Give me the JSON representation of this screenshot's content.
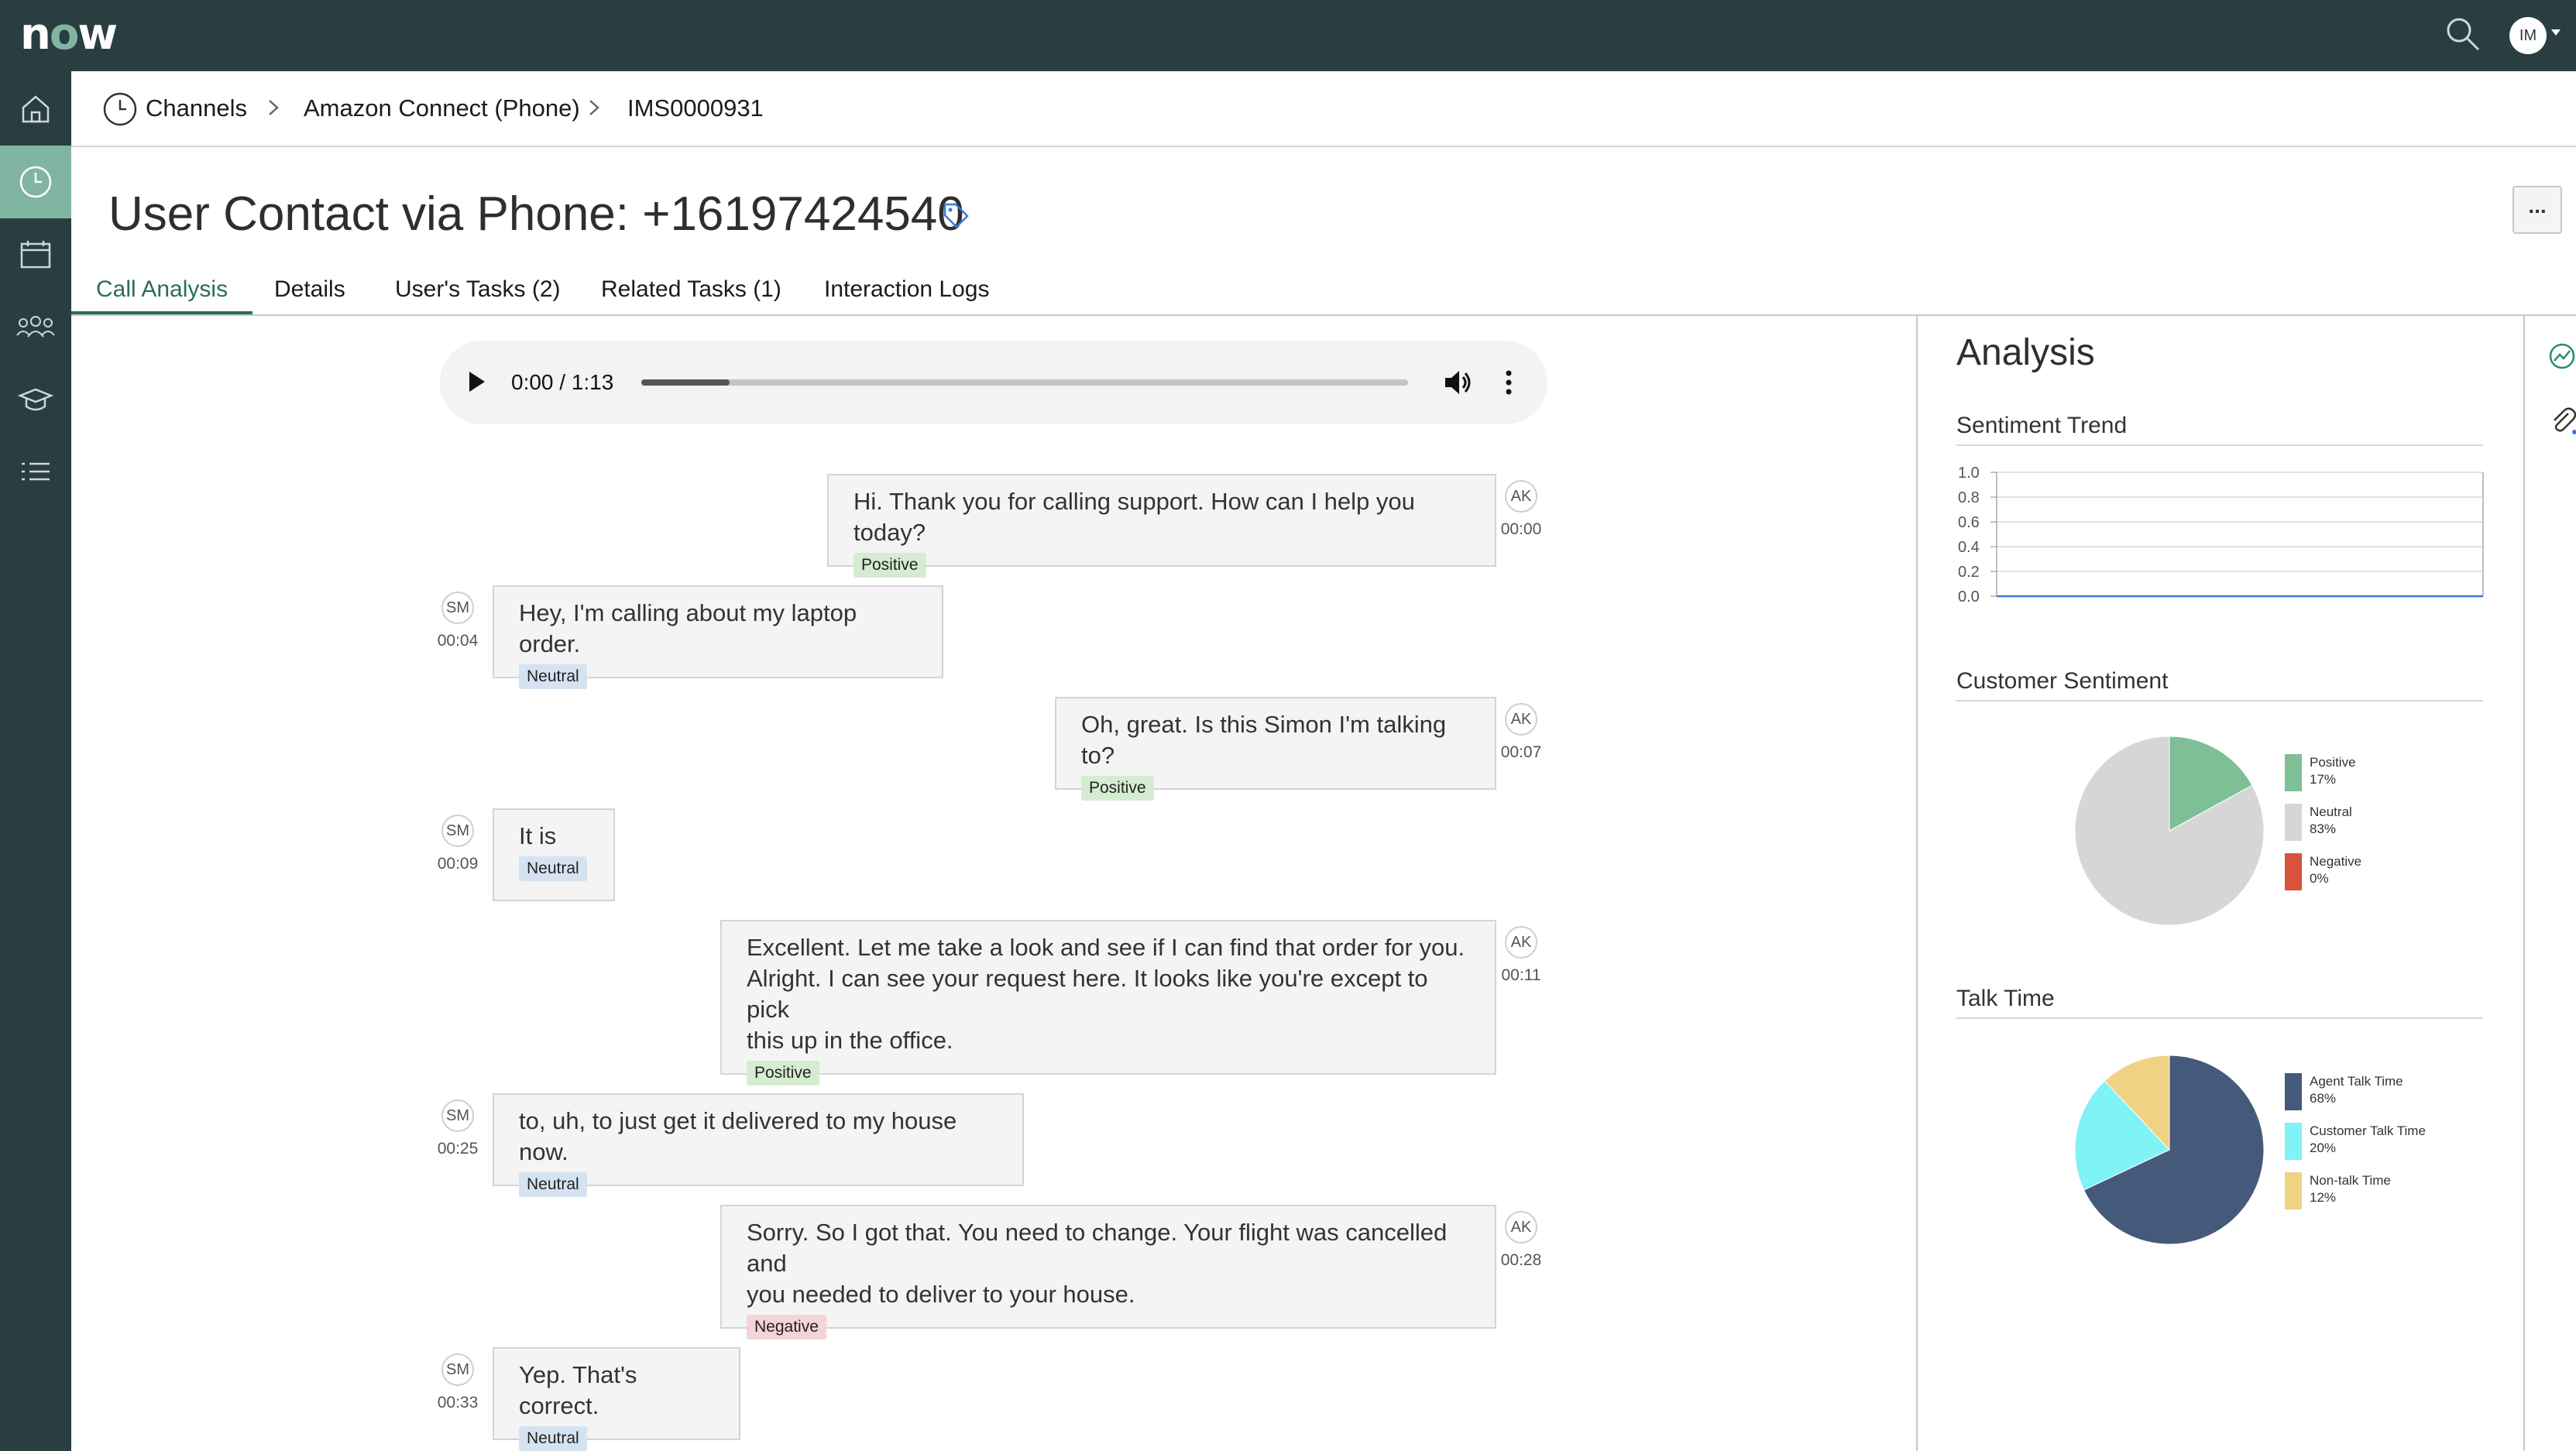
{
  "app": {
    "logo": "now",
    "avatar_initials": "IM"
  },
  "breadcrumb": [
    "Channels",
    "Amazon Connect (Phone)",
    "IMS0000931"
  ],
  "page": {
    "title": "User Contact via Phone: +16197424540",
    "more_label": "..."
  },
  "tabs": [
    {
      "label": "Call Analysis",
      "active": true
    },
    {
      "label": "Details",
      "active": false
    },
    {
      "label": "User's Tasks (2)",
      "active": false
    },
    {
      "label": "Related Tasks (1)",
      "active": false
    },
    {
      "label": "Interaction Logs",
      "active": false
    }
  ],
  "audio": {
    "time": "0:00 / 1:13",
    "progress_fraction": 0.0
  },
  "transcript": [
    {
      "speaker": "AK",
      "time": "00:00",
      "lines": [
        "Hi. Thank you for calling support. How can I help you today?"
      ],
      "sentiment": "Positive"
    },
    {
      "speaker": "SM",
      "time": "00:04",
      "lines": [
        "Hey, I'm calling about my laptop order."
      ],
      "sentiment": "Neutral"
    },
    {
      "speaker": "AK",
      "time": "00:07",
      "lines": [
        "Oh, great. Is this Simon I'm talking to?"
      ],
      "sentiment": "Positive"
    },
    {
      "speaker": "SM",
      "time": "00:09",
      "lines": [
        "It is"
      ],
      "sentiment": "Neutral"
    },
    {
      "speaker": "AK",
      "time": "00:11",
      "lines": [
        "Excellent. Let me take a look and see if I can find that order for you.",
        "Alright. I can see your request here. It looks like you're except to pick",
        "this up in the office."
      ],
      "sentiment": "Positive"
    },
    {
      "speaker": "SM",
      "time": "00:25",
      "lines": [
        "to, uh, to just get it delivered to my house now."
      ],
      "sentiment": "Neutral"
    },
    {
      "speaker": "AK",
      "time": "00:28",
      "lines": [
        "Sorry. So I got that. You need to change. Your flight was cancelled and",
        "you needed to deliver to your house."
      ],
      "sentiment": "Negative"
    },
    {
      "speaker": "SM",
      "time": "00:33",
      "lines": [
        "Yep. That's correct."
      ],
      "sentiment": "Neutral"
    }
  ],
  "analysis": {
    "title": "Analysis",
    "sentiment_trend_title": "Sentiment Trend",
    "customer_sentiment_title": "Customer Sentiment",
    "talk_time_title": "Talk Time"
  },
  "chart_data": [
    {
      "type": "line",
      "title": "Sentiment Trend",
      "yticks": [
        "1.0",
        "0.8",
        "0.6",
        "0.4",
        "0.2",
        "0.0"
      ],
      "ylim": [
        0,
        1
      ],
      "grid": true,
      "series": []
    },
    {
      "type": "pie",
      "title": "Customer Sentiment",
      "legend_position": "right",
      "slices": [
        {
          "name": "Positive",
          "value": 17,
          "label": "17%",
          "color": "#7ebf96"
        },
        {
          "name": "Neutral",
          "value": 83,
          "label": "83%",
          "color": "#d6d6d6"
        },
        {
          "name": "Negative",
          "value": 0,
          "label": "0%",
          "color": "#d9533c"
        }
      ]
    },
    {
      "type": "pie",
      "title": "Talk Time",
      "legend_position": "right",
      "slices": [
        {
          "name": "Agent Talk Time",
          "value": 68,
          "label": "68%",
          "color": "#455a7a"
        },
        {
          "name": "Customer Talk Time",
          "value": 20,
          "label": "20%",
          "color": "#7ff3f5"
        },
        {
          "name": "Non-talk Time",
          "value": 12,
          "label": "12%",
          "color": "#efd283"
        }
      ]
    }
  ]
}
